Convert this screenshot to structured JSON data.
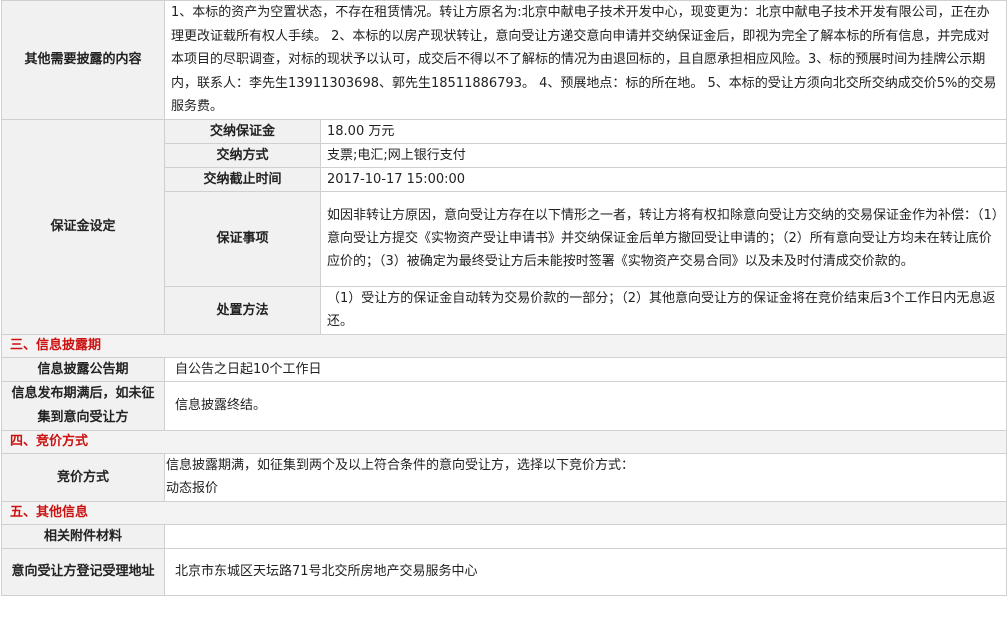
{
  "other_disclosure": {
    "label": "其他需要披露的内容",
    "text": "1、本标的资产为空置状态，不存在租赁情况。转让方原名为:北京中献电子技术开发中心，现变更为：北京中献电子技术开发有限公司，正在办理更改证载所有权人手续。 2、本标的以房产现状转让，意向受让方递交意向申请并交纳保证金后，即视为完全了解本标的所有信息，并完成对本项目的尽职调查，对标的现状予以认可，成交后不得以不了解标的情况为由退回标的，且自愿承担相应风险。3、标的预展时间为挂牌公示期内，联系人：李先生13911303698、郭先生18511886793。 4、预展地点：标的所在地。 5、本标的受让方须向北交所交纳成交价5%的交易服务费。"
  },
  "deposit": {
    "label": "保证金设定",
    "rows": [
      {
        "label": "交纳保证金",
        "value": "18.00 万元"
      },
      {
        "label": "交纳方式",
        "value": "支票;电汇;网上银行支付"
      },
      {
        "label": "交纳截止时间",
        "value": "2017-10-17 15:00:00"
      },
      {
        "label": "保证事项",
        "value": "如因非转让方原因，意向受让方存在以下情形之一者，转让方将有权扣除意向受让方交纳的交易保证金作为补偿：（1）意向受让方提交《实物资产受让申请书》并交纳保证金后单方撤回受让申请的；（2）所有意向受让方均未在转让底价应价的；（3）被确定为最终受让方后未能按时签署《实物资产交易合同》以及未及时付清成交价款的。"
      },
      {
        "label": "处置方法",
        "value": "（1）受让方的保证金自动转为交易价款的一部分；（2）其他意向受让方的保证金将在竞价结束后3个工作日内无息返还。"
      }
    ]
  },
  "sections": {
    "disclosure": "三、信息披露期",
    "bidding": "四、竞价方式",
    "other": "五、其他信息"
  },
  "disclosure": {
    "period_label": "信息披露公告期",
    "period_value": "自公告之日起10个工作日",
    "expiry_label": "信息发布期满后，如未征集到意向受让方",
    "expiry_value": "信息披露终结。"
  },
  "bidding": {
    "label": "竞价方式",
    "line1": "信息披露期满，如征集到两个及以上符合条件的意向受让方，选择以下竞价方式：",
    "line2": "动态报价"
  },
  "other_info": {
    "attachments_label": "相关附件材料",
    "attachments_value": "",
    "address_label": "意向受让方登记受理地址",
    "address_value": "北京市东城区天坛路71号北交所房地产交易服务中心"
  }
}
